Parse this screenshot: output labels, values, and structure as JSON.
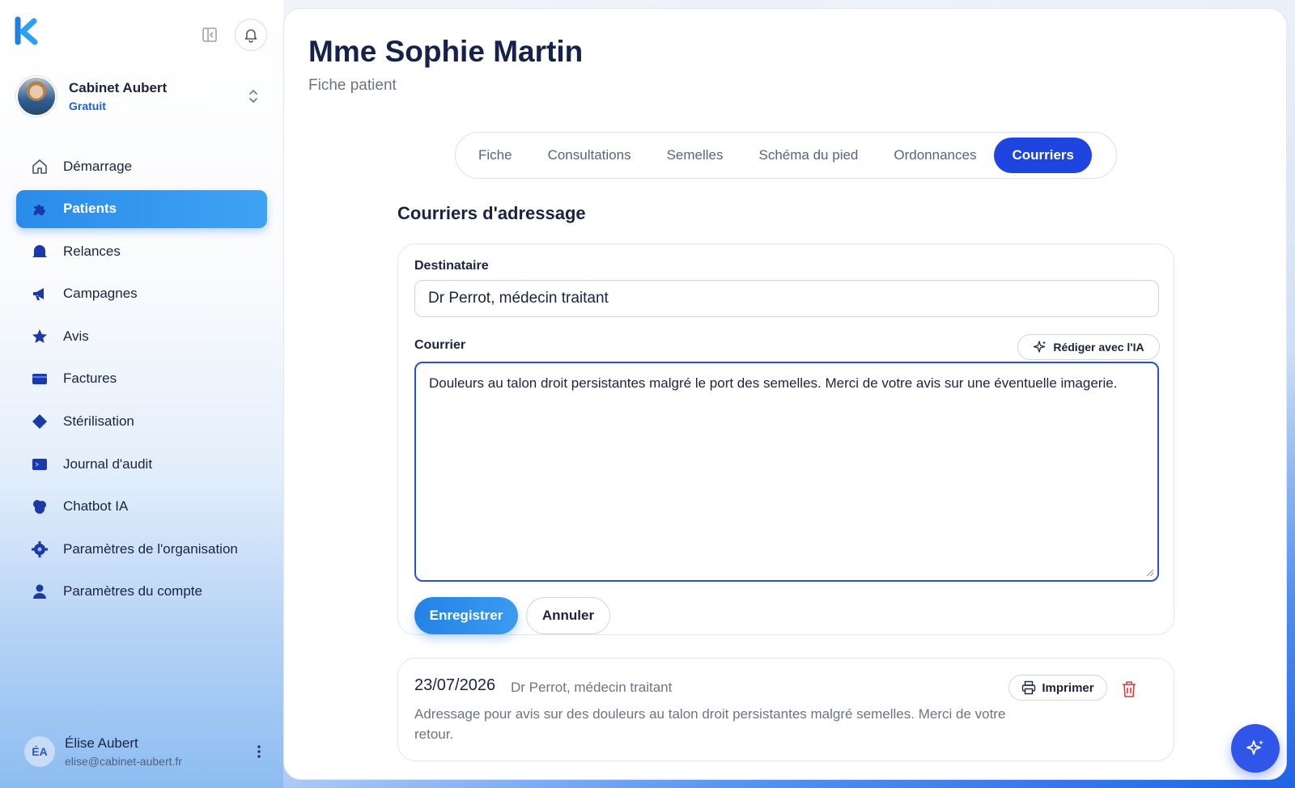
{
  "sidebar": {
    "org": {
      "name": "Cabinet Aubert",
      "plan": "Gratuit"
    },
    "items": [
      {
        "label": "Démarrage",
        "icon": "home-icon"
      },
      {
        "label": "Patients",
        "icon": "puzzle-icon",
        "active": true
      },
      {
        "label": "Relances",
        "icon": "bell-icon"
      },
      {
        "label": "Campagnes",
        "icon": "megaphone-icon"
      },
      {
        "label": "Avis",
        "icon": "star-icon"
      },
      {
        "label": "Factures",
        "icon": "invoice-icon"
      },
      {
        "label": "Stérilisation",
        "icon": "diamond-icon"
      },
      {
        "label": "Journal d'audit",
        "icon": "terminal-icon"
      },
      {
        "label": "Chatbot IA",
        "icon": "chatbot-icon"
      },
      {
        "label": "Paramètres de l'organisation",
        "icon": "gear-icon"
      },
      {
        "label": "Paramètres du compte",
        "icon": "person-icon"
      }
    ],
    "user": {
      "initials": "ÉA",
      "name": "Élise Aubert",
      "email": "elise@cabinet-aubert.fr"
    }
  },
  "page": {
    "title": "Mme Sophie Martin",
    "subtitle": "Fiche patient"
  },
  "tabs": [
    {
      "label": "Fiche"
    },
    {
      "label": "Consultations"
    },
    {
      "label": "Semelles"
    },
    {
      "label": "Schéma du pied"
    },
    {
      "label": "Ordonnances"
    },
    {
      "label": "Courriers",
      "active": true
    }
  ],
  "section": {
    "title": "Courriers d'adressage"
  },
  "form": {
    "recipient_label": "Destinataire",
    "recipient_value": "Dr Perrot, médecin traitant",
    "letter_label": "Courrier",
    "ai_button": "Rédiger avec l'IA",
    "letter_value": "Douleurs au talon droit persistantes malgré le port des semelles. Merci de votre avis sur une éventuelle imagerie.",
    "save_button": "Enregistrer",
    "cancel_button": "Annuler"
  },
  "letters": [
    {
      "date": "23/07/2026",
      "recipient": "Dr Perrot, médecin traitant",
      "body": "Adressage pour avis sur des douleurs au talon droit persistantes malgré semelles. Merci de votre retour.",
      "print_button": "Imprimer"
    }
  ],
  "colors": {
    "accent": "#1f45e0",
    "primary_button": "#2283e6",
    "danger": "#d93a3a"
  }
}
